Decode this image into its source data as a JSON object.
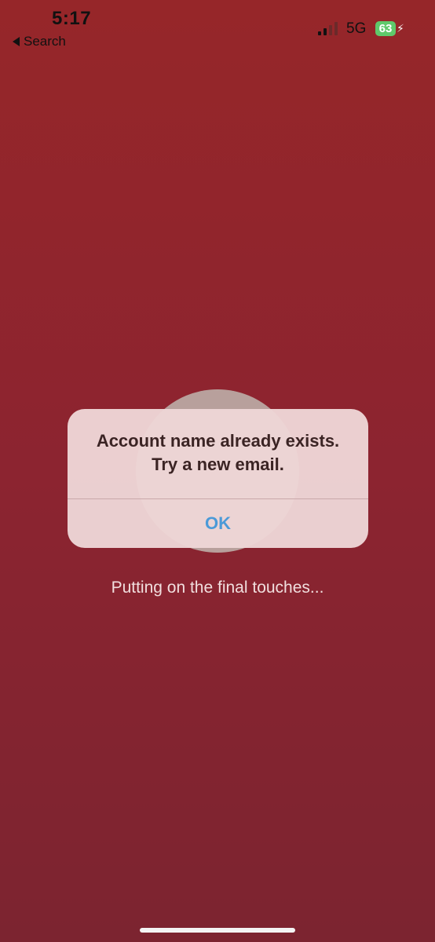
{
  "status_bar": {
    "time": "5:17",
    "back_label": "Search",
    "network": "5G",
    "battery": "63",
    "signal_bars_active": 2,
    "signal_bars_total": 4,
    "battery_color": "#5fc96b"
  },
  "alert": {
    "message": "Account name already exists. Try a new email.",
    "ok_label": "OK"
  },
  "loading": {
    "text": "Putting on the final touches..."
  },
  "colors": {
    "background": "#8c2430",
    "alert_button": "#4b9ad8"
  }
}
